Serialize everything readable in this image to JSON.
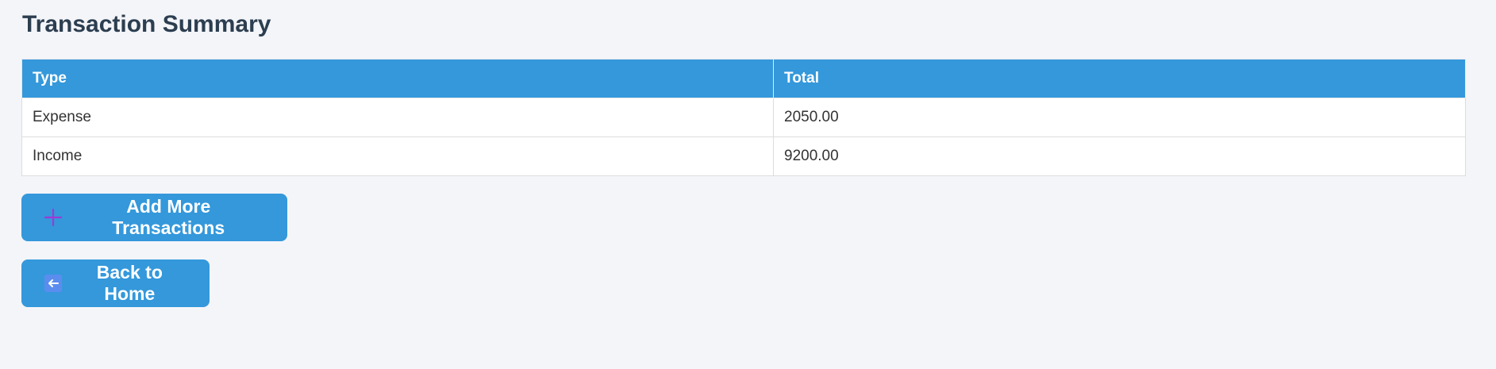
{
  "page": {
    "title": "Transaction Summary"
  },
  "table": {
    "headers": [
      "Type",
      "Total"
    ],
    "rows": [
      {
        "type": "Expense",
        "total": "2050.00"
      },
      {
        "type": "Income",
        "total": "9200.00"
      }
    ]
  },
  "buttons": {
    "add_more": {
      "label": "Add More Transactions",
      "icon": "plus-icon"
    },
    "back_home": {
      "label": "Back to Home",
      "icon": "left-arrow-icon"
    }
  },
  "colors": {
    "accent": "#3498db",
    "title": "#2c3e50",
    "background": "#f4f5f9",
    "plus_icon": "#9b3bd6",
    "arrow_icon_box": "#5b8def"
  }
}
